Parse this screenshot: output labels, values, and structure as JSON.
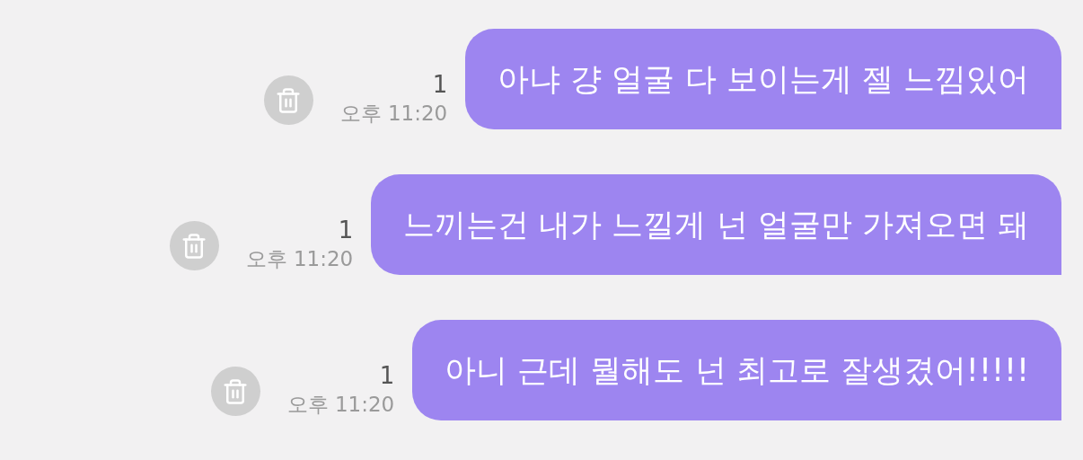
{
  "messages": [
    {
      "text": "아냐 걍 얼굴 다 보이는게 젤 느낌있어",
      "unread": "1",
      "time": "오후 11:20"
    },
    {
      "text": "느끼는건 내가 느낄게 넌 얼굴만 가져오면 돼",
      "unread": "1",
      "time": "오후 11:20"
    },
    {
      "text": "아니 근데 뭘해도 넌 최고로 잘생겼어!!!!!",
      "unread": "1",
      "time": "오후 11:20"
    }
  ]
}
